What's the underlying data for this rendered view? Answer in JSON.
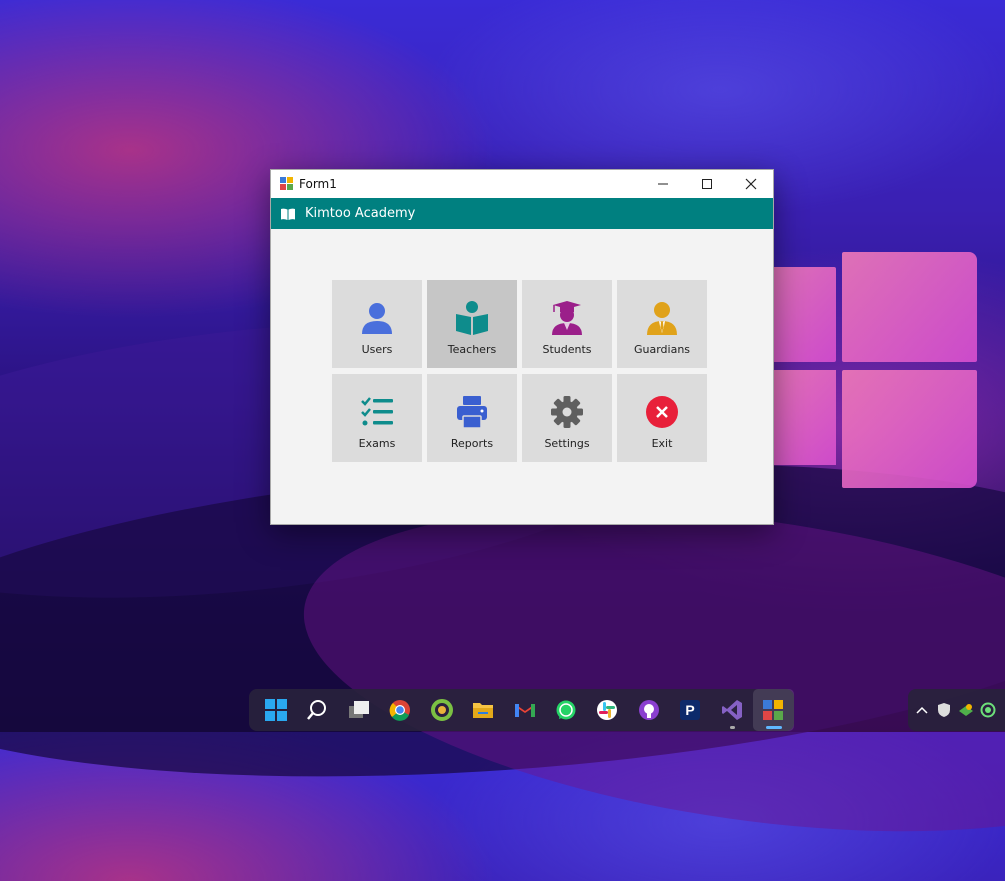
{
  "window": {
    "title": "Form1"
  },
  "header": {
    "title": "Kimtoo Academy"
  },
  "tiles": [
    {
      "label": "Users",
      "icon": "user-icon",
      "color": "#4a6fdc"
    },
    {
      "label": "Teachers",
      "icon": "teacher-icon",
      "color": "#0e8c8c"
    },
    {
      "label": "Students",
      "icon": "student-icon",
      "color": "#9b1f8a"
    },
    {
      "label": "Guardians",
      "icon": "guardian-icon",
      "color": "#e0a21a"
    },
    {
      "label": "Exams",
      "icon": "checklist-icon",
      "color": "#0e8c8c"
    },
    {
      "label": "Reports",
      "icon": "printer-icon",
      "color": "#3a5fd0"
    },
    {
      "label": "Settings",
      "icon": "gear-icon",
      "color": "#5f5f5f"
    },
    {
      "label": "Exit",
      "icon": "exit-icon",
      "color": "#e8203a"
    }
  ],
  "taskbar": {
    "items": [
      "start-icon",
      "search-icon",
      "task-view-icon",
      "chrome-icon",
      "browser-icon",
      "file-explorer-icon",
      "gmail-icon",
      "whatsapp-icon",
      "slack-icon",
      "github-icon",
      "p-app-icon",
      "visual-studio-icon",
      "form1-app-icon"
    ]
  },
  "colors": {
    "accent": "#008080",
    "tile_bg": "#dcdcdc",
    "tile_active_bg": "#c6c6c6"
  }
}
